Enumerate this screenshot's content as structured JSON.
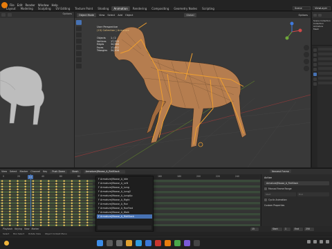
{
  "app": {
    "menus": [
      "File",
      "Edit",
      "Render",
      "Window",
      "Help"
    ],
    "tabs": [
      "Layout",
      "Modeling",
      "Sculpting",
      "UV Editing",
      "Texture Paint",
      "Shading",
      "Animation",
      "Rendering",
      "Compositing",
      "Geometry Nodes",
      "Scripting"
    ],
    "active_tab": "Animation",
    "scene_label": "Scene",
    "view_layer_label": "ViewLayer"
  },
  "left_editor": {
    "options_label": "Options"
  },
  "viewport": {
    "mode": "Object Mode",
    "menu": [
      "View",
      "Select",
      "Add",
      "Object"
    ],
    "orientation": "Global",
    "view_name": "User Perspective",
    "collection": "(15) Collection | Armature",
    "stats": [
      {
        "k": "Objects",
        "v": "1 / 2"
      },
      {
        "k": "Vertices",
        "v": "17,333"
      },
      {
        "k": "Edges",
        "v": "34,966"
      },
      {
        "k": "Faces",
        "v": "17,652"
      },
      {
        "k": "Triangles",
        "v": "34,506"
      }
    ],
    "options_label": "Options"
  },
  "outliner": {
    "items": [
      "Scene Collection",
      "Collection",
      "Armature",
      "Mesh"
    ]
  },
  "dopesheet": {
    "menu": [
      "View",
      "Select",
      "Marker",
      "Channel",
      "Key"
    ],
    "push_down": "Push Down",
    "stash": "Stash",
    "action_field": "Armature|Moose_A_RidiSlack",
    "snap": "Nearest Frame",
    "ruler": [
      "0",
      "20",
      "40",
      "60",
      "80",
      "100",
      "120",
      "140",
      "160",
      "180",
      "200",
      "220",
      "240"
    ],
    "current_frame": "15",
    "footer": [
      "Playback",
      "Keying",
      "View",
      "Marker"
    ],
    "start": "1",
    "end": "250",
    "frame_label": "Start",
    "end_label": "End"
  },
  "action_panel": {
    "header": "Action",
    "action_name": "Armature|Moose_A_RidiSlack",
    "manual_frame_range": "Manual Frame Range",
    "start": "Start",
    "end": "End",
    "cyclic": "Cyclic Animation",
    "custom_properties": "Custom Properties"
  },
  "action_list": {
    "items": [
      "F Armature|Moose_A_Idle",
      "F Armature|Moose_A_Left",
      "F Armature|Moose_A_Long",
      "F Armature|Moose_A_Long2",
      "F Armature|Moose_A_LongUp",
      "F Armature|Moose_A_Right",
      "F Armature|Moose_A_Run",
      "F Armature|Moose_A_RunFast",
      "F Armature|Moose_A_Walk",
      "F Armature|Moose_A_RidiSlack"
    ],
    "selected_index": 9,
    "search_placeholder": ""
  },
  "status_bar": {
    "items": [
      "Select",
      "Box Select",
      "Rotate View",
      "Object Context Menu"
    ]
  },
  "colors": {
    "accent": "#4772b3",
    "bone": "#f0a030",
    "blender_orange": "#e87d0d"
  }
}
